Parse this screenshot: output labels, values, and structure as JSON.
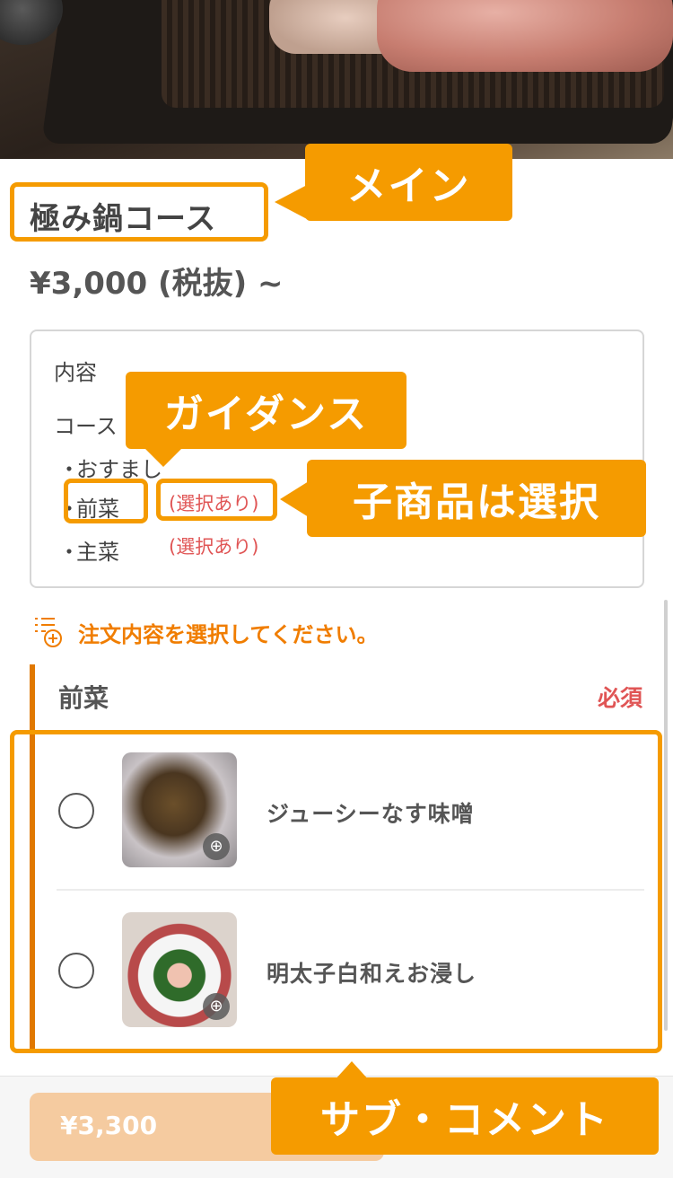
{
  "product": {
    "title": "極み鍋コース",
    "price": "¥3,000 (税抜) ~"
  },
  "contents": {
    "heading": "内容",
    "course": "コース",
    "items": [
      {
        "dot": "・",
        "label": "おすまし",
        "selectable": ""
      },
      {
        "dot": "・",
        "label": "前菜",
        "selectable": "(選択あり)"
      },
      {
        "dot": "・",
        "label": "主菜",
        "selectable": "(選択あり)"
      }
    ]
  },
  "guide": {
    "text": "注文内容を選択してください。",
    "icon": "list-add-icon"
  },
  "section": {
    "title": "前菜",
    "required": "必須",
    "options": [
      {
        "name": "ジューシーなす味噌",
        "zoom_icon": "zoom-in-icon"
      },
      {
        "name": "明太子白和えお浸し",
        "zoom_icon": "zoom-in-icon"
      }
    ]
  },
  "footer": {
    "cart_total": "¥3,300"
  },
  "annotations": {
    "main": "メイン",
    "guidance": "ガイダンス",
    "child_selection": "子商品は選択",
    "sub_comment": "サブ・コメント"
  },
  "colors": {
    "accent": "#f59b00",
    "guide_text": "#f07d00",
    "section_bar": "#e07800",
    "required": "#e05555",
    "cart_button": "#f5cba0"
  }
}
